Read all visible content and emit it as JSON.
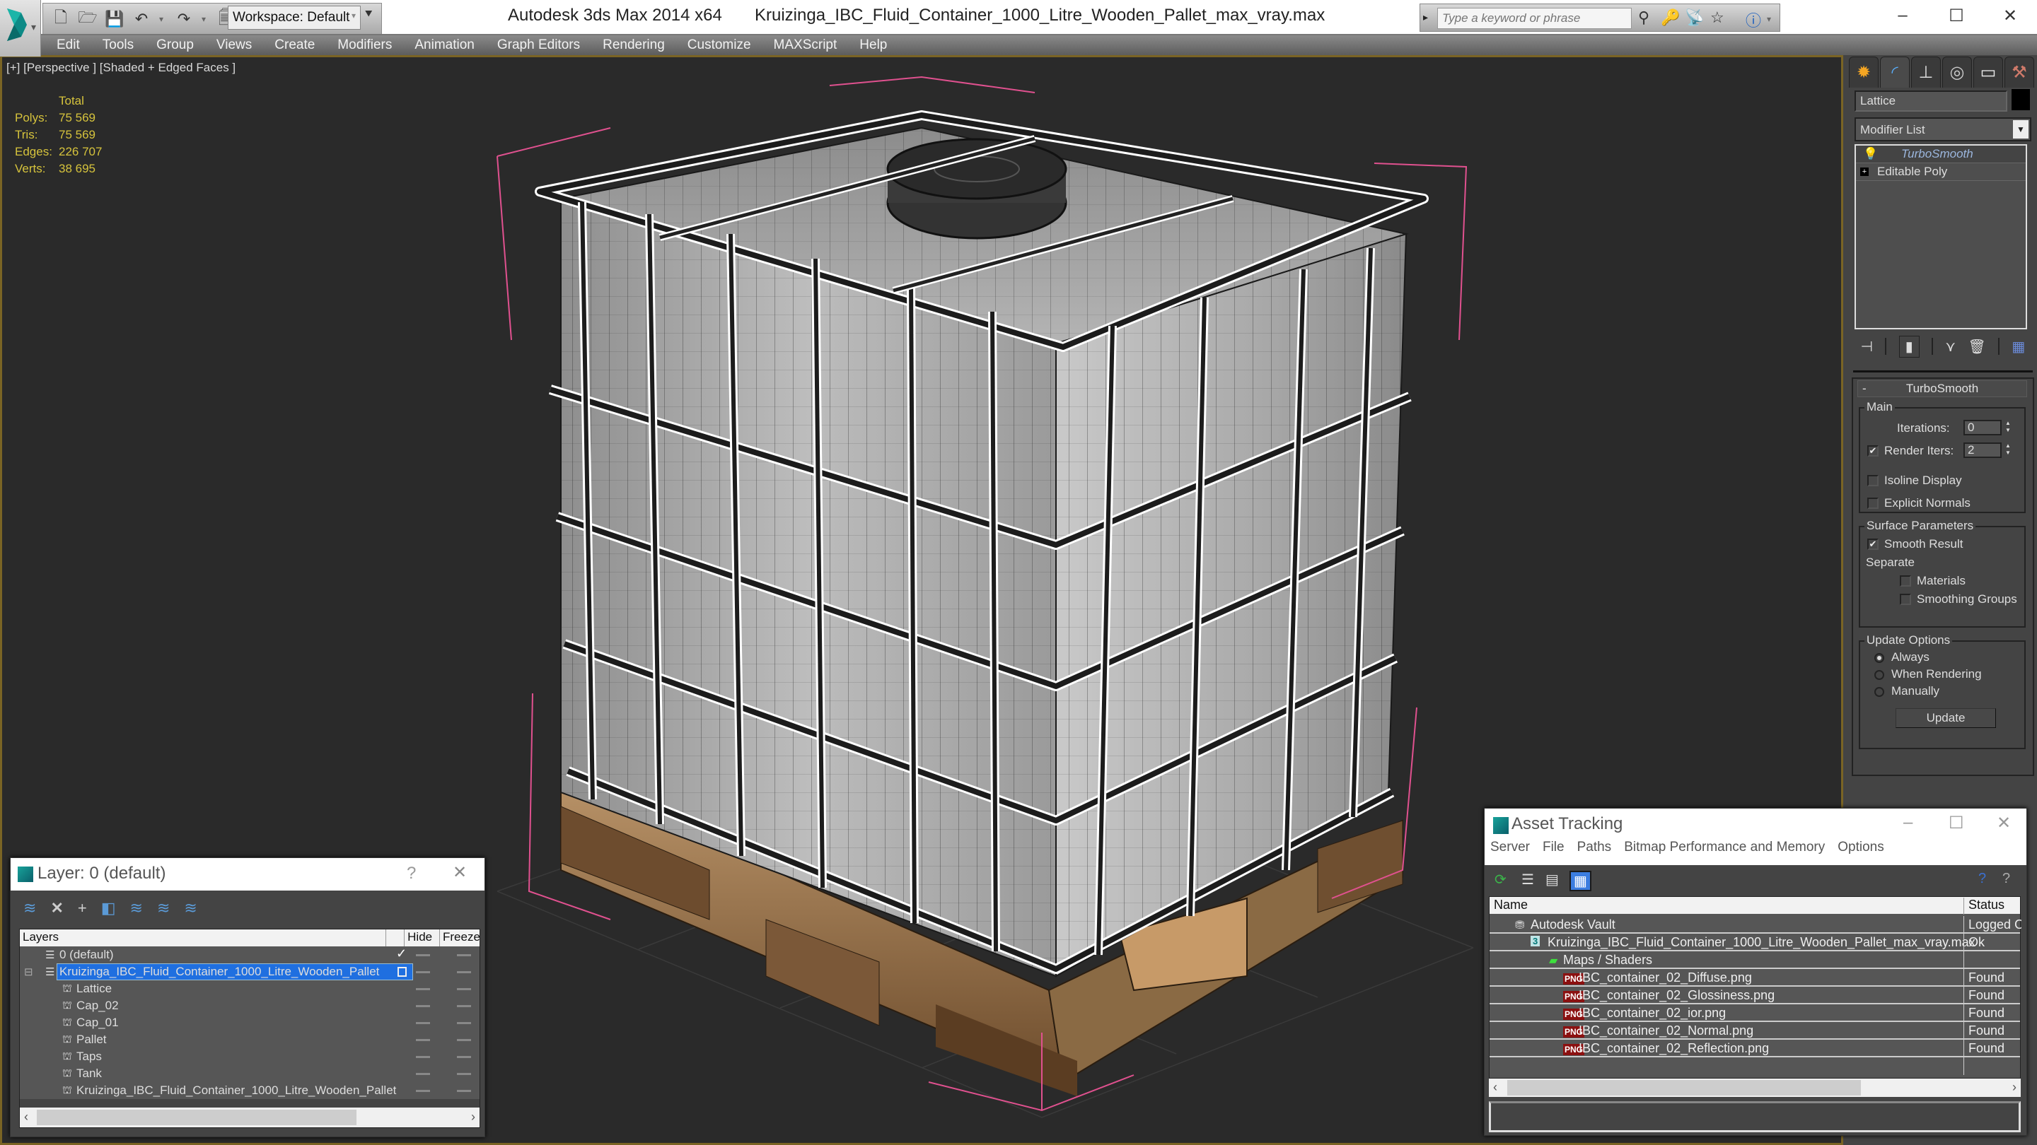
{
  "titlebar": {
    "app_title": "Autodesk 3ds Max  2014 x64",
    "file_title": "Kruizinga_IBC_Fluid_Container_1000_Litre_Wooden_Pallet_max_vray.max",
    "workspace": "Workspace: Default",
    "search_placeholder": "Type a keyword or phrase",
    "quick_access_icons": [
      "new-file-icon",
      "open-file-icon",
      "save-icon",
      "undo-icon",
      "redo-icon",
      "project-folder-icon"
    ],
    "infocenter_icons": [
      "binoculars-icon",
      "key-icon",
      "satellite-icon",
      "star-icon",
      "help-icon"
    ],
    "window_controls": {
      "minimize": "–",
      "maximize": "☐",
      "close": "✕"
    }
  },
  "menu": [
    "Edit",
    "Tools",
    "Group",
    "Views",
    "Create",
    "Modifiers",
    "Animation",
    "Graph Editors",
    "Rendering",
    "Customize",
    "MAXScript",
    "Help"
  ],
  "viewport": {
    "label": "[+] [Perspective ] [Shaded + Edged Faces ]",
    "stats": {
      "header": "Total",
      "rows": [
        {
          "key": "Polys:",
          "value": "75 569"
        },
        {
          "key": "Tris:",
          "value": "75 569"
        },
        {
          "key": "Edges:",
          "value": "226 707"
        },
        {
          "key": "Verts:",
          "value": "38 695"
        }
      ]
    }
  },
  "command_panel": {
    "tabs": [
      "create-tab",
      "modify-tab",
      "hierarchy-tab",
      "motion-tab",
      "display-tab",
      "utilities-tab"
    ],
    "active_tab": "modify-tab",
    "object_name": "Lattice",
    "object_color": "#000000",
    "modifier_list": "Modifier List",
    "stack": [
      {
        "label": "TurboSmooth",
        "active": true
      },
      {
        "label": "Editable Poly",
        "active": false
      }
    ],
    "turbosmooth": {
      "title": "TurboSmooth",
      "collapse": "-",
      "main_label": "Main",
      "iterations_label": "Iterations:",
      "iterations": "0",
      "render_iters_label": "Render Iters:",
      "render_iters": "2",
      "render_iters_checked": true,
      "isoline_label": "Isoline Display",
      "isoline_checked": false,
      "explicit_normals_label": "Explicit Normals",
      "explicit_normals_checked": false,
      "surface_label": "Surface Parameters",
      "smooth_result_label": "Smooth Result",
      "smooth_result_checked": true,
      "separate_label": "Separate",
      "materials_label": "Materials",
      "smoothing_groups_label": "Smoothing Groups",
      "update_options_label": "Update Options",
      "radio": [
        "Always",
        "When Rendering",
        "Manually"
      ],
      "radio_selected": "Always",
      "update_button": "Update"
    }
  },
  "layer_dialog": {
    "title": "Layer: 0 (default)",
    "help": "?",
    "close": "✕",
    "columns": [
      "Layers",
      "",
      "Hide",
      "Freeze"
    ],
    "rows": [
      {
        "name": "0 (default)",
        "level": 0,
        "current": true,
        "selected": false
      },
      {
        "name": "Kruizinga_IBC_Fluid_Container_1000_Litre_Wooden_Pallet",
        "level": 0,
        "current": false,
        "selected": true
      },
      {
        "name": "Lattice",
        "level": 1
      },
      {
        "name": "Cap_02",
        "level": 1
      },
      {
        "name": "Cap_01",
        "level": 1
      },
      {
        "name": "Pallet",
        "level": 1
      },
      {
        "name": "Taps",
        "level": 1
      },
      {
        "name": "Tank",
        "level": 1
      },
      {
        "name": "Kruizinga_IBC_Fluid_Container_1000_Litre_Wooden_Pallet",
        "level": 1
      }
    ]
  },
  "asset_tracking": {
    "title": "Asset Tracking",
    "menu": [
      "Server",
      "File",
      "Paths",
      "Bitmap Performance and Memory",
      "Options"
    ],
    "columns": [
      "Name",
      "Status"
    ],
    "rows": [
      {
        "name": "Autodesk Vault",
        "status": "Logged Out",
        "level": 0,
        "icon": "vault-icon"
      },
      {
        "name": "Kruizinga_IBC_Fluid_Container_1000_Litre_Wooden_Pallet_max_vray.max",
        "status": "Ok",
        "level": 1,
        "icon": "max-file-icon"
      },
      {
        "name": "Maps / Shaders",
        "status": "",
        "level": 2,
        "icon": "maps-icon"
      },
      {
        "name": "IBC_container_02_Diffuse.png",
        "status": "Found",
        "level": 3,
        "icon": "png-icon"
      },
      {
        "name": "IBC_container_02_Glossiness.png",
        "status": "Found",
        "level": 3,
        "icon": "png-icon"
      },
      {
        "name": "IBC_container_02_ior.png",
        "status": "Found",
        "level": 3,
        "icon": "png-icon"
      },
      {
        "name": "IBC_container_02_Normal.png",
        "status": "Found",
        "level": 3,
        "icon": "png-icon"
      },
      {
        "name": "IBC_container_02_Reflection.png",
        "status": "Found",
        "level": 3,
        "icon": "png-icon"
      }
    ]
  }
}
